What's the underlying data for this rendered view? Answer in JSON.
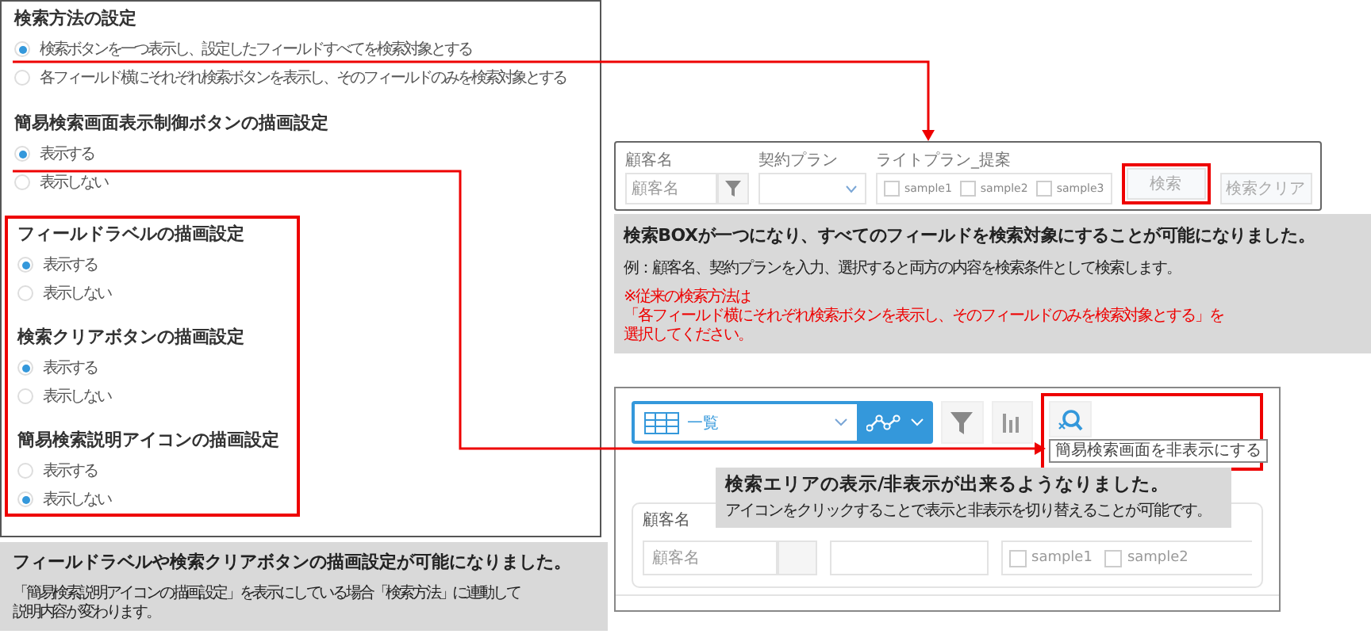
{
  "settings": [
    {
      "title": "検索方法の設定",
      "options": [
        {
          "label": "検索ボタンを一つ表示し、設定したフィールドすべてを検索対象とする",
          "selected": true
        },
        {
          "label": "各フィールド横にそれぞれ検索ボタンを表示し、そのフィールドのみを検索対象とする",
          "selected": false
        }
      ]
    },
    {
      "title": "簡易検索画面表示制御ボタンの描画設定",
      "options": [
        {
          "label": "表示する",
          "selected": true
        },
        {
          "label": "表示しない",
          "selected": false
        }
      ]
    }
  ],
  "highlighted_settings": [
    {
      "title": "フィールドラベルの描画設定",
      "options": [
        {
          "label": "表示する",
          "selected": true
        },
        {
          "label": "表示しない",
          "selected": false
        }
      ]
    },
    {
      "title": "検索クリアボタンの描画設定",
      "options": [
        {
          "label": "表示する",
          "selected": true
        },
        {
          "label": "表示しない",
          "selected": false
        }
      ]
    },
    {
      "title": "簡易検索説明アイコンの描画設定",
      "options": [
        {
          "label": "表示する",
          "selected": false
        },
        {
          "label": "表示しない",
          "selected": true
        }
      ]
    }
  ],
  "settings_note": {
    "title": "フィールドラベルや検索クリアボタンの描画設定が可能になりました。",
    "body": [
      "「簡易検索説明アイコンの描画設定」を表示にしている場合「検索方法」に連動して",
      "説明内容が変わります。"
    ]
  },
  "search_bar": {
    "customer_label": "顧客名",
    "customer_placeholder": "顧客名",
    "plan_label": "契約プラン",
    "light_plan_label": "ライトプラン_提案",
    "checkboxes": [
      {
        "label": "sample1",
        "checked": false
      },
      {
        "label": "sample2",
        "checked": false
      },
      {
        "label": "sample3",
        "checked": false
      }
    ],
    "search_button": "検索",
    "clear_button": "検索クリア"
  },
  "search_note": {
    "title": "検索BOXが一つになり、すべてのフィールドを検索対象にすることが可能になりました。",
    "body": "例：顧客名、契約プランを入力、選択すると両方の内容を検索条件として検索します。",
    "warning": [
      "※従来の検索方法は",
      "「各フィールド横にそれぞれ検索ボタンを表示し、そのフィールドのみを検索対象とする」を",
      "選択してください。"
    ]
  },
  "list_view": {
    "view_name": "一覧",
    "tooltip": "簡易検索画面を非表示にする",
    "field_label": "顧客名",
    "placeholder": "顧客名",
    "checkboxes": [
      {
        "label": "sample1",
        "checked": false
      },
      {
        "label": "sample2",
        "checked": false
      }
    ]
  },
  "area_note": {
    "title": "検索エリアの表示/非表示が出来るようなりました。",
    "body": "アイコンをクリックすることで表示と非表示を切り替えることが可能です。"
  }
}
